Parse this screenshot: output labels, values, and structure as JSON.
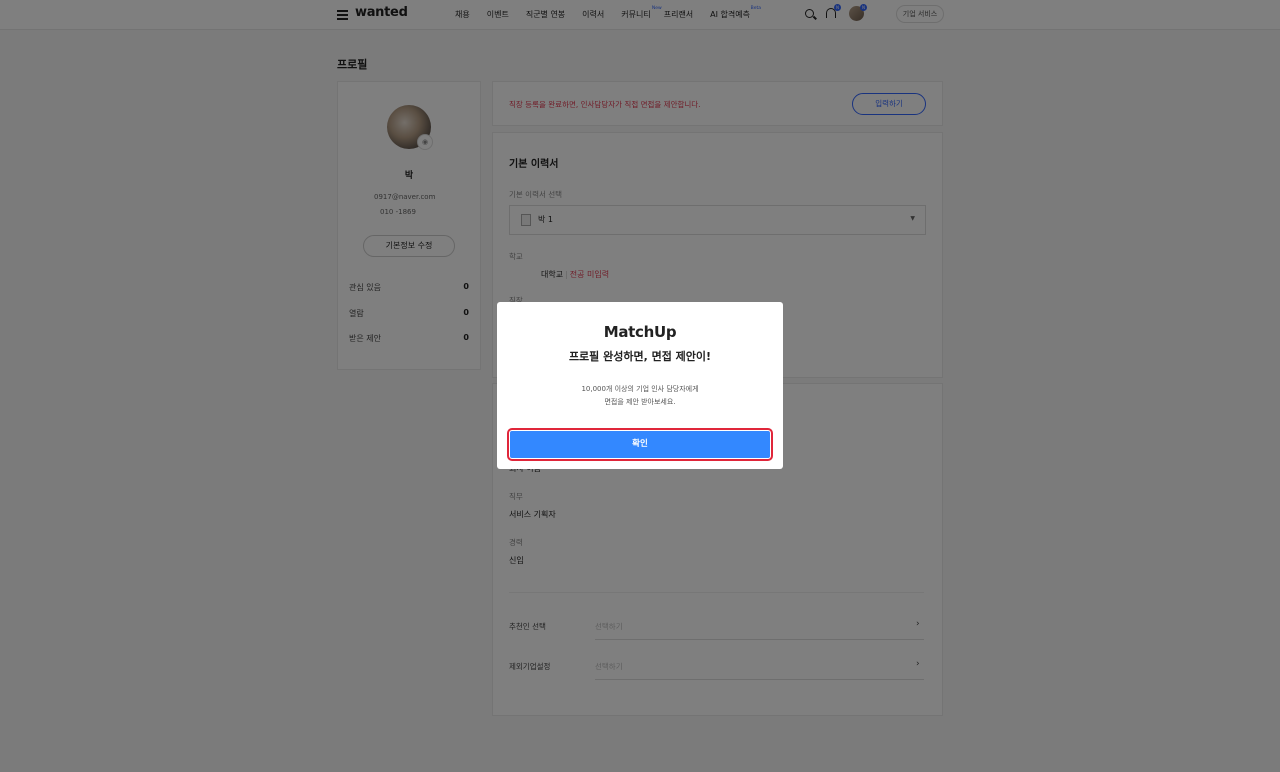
{
  "header": {
    "logo": "wanted",
    "nav": [
      {
        "label": "채용",
        "sup": ""
      },
      {
        "label": "이벤트",
        "sup": ""
      },
      {
        "label": "직군별 연봉",
        "sup": ""
      },
      {
        "label": "이력서",
        "sup": ""
      },
      {
        "label": "커뮤니티",
        "sup": "New"
      },
      {
        "label": "프리랜서",
        "sup": ""
      },
      {
        "label": "AI 합격예측",
        "sup": "Beta"
      }
    ],
    "notification_badge": "N",
    "avatar_badge": "N",
    "corp_service": "기업 서비스"
  },
  "page_title": "프로필",
  "profile": {
    "name": "박",
    "email": "0917@naver.com",
    "phone": "010        -1869",
    "edit_button": "기본정보 수정",
    "stats": [
      {
        "label": "관심 있음",
        "value": "0"
      },
      {
        "label": "열람",
        "value": "0"
      },
      {
        "label": "받은 제안",
        "value": "0"
      }
    ]
  },
  "notice": {
    "message": "직장 등록을 완료하면, 인사담당자가 직접 면접을 제안합니다.",
    "button": "입력하기"
  },
  "resume": {
    "title": "기본 이력서",
    "select_label": "기본 이력서 선택",
    "selected_value": "박          1",
    "school_label": "학교",
    "school_value": "대학교",
    "major_missing": "전공 미입력",
    "job_label_partial": "직장",
    "company_partial": "회사 이름",
    "duty_label": "직무",
    "duty_value": "서비스 기획자",
    "career_label": "경력",
    "career_value": "신입",
    "referrer_label": "추천인 선택",
    "referrer_placeholder": "선택하기",
    "exclude_label": "제외기업설정",
    "exclude_placeholder": "선택하기"
  },
  "modal": {
    "brand": "MatchUp",
    "title": "프로필 완성하면, 면접 제안이!",
    "desc_line1": "10,000개 이상의 기업 인사 담당자에게",
    "desc_line2": "면접을 제안 받아보세요.",
    "confirm": "확인"
  },
  "colors": {
    "accent": "#3366ff",
    "confirm_button": "#3388ff",
    "highlight_outline": "#e0263a",
    "warning_text": "#e03b52"
  }
}
